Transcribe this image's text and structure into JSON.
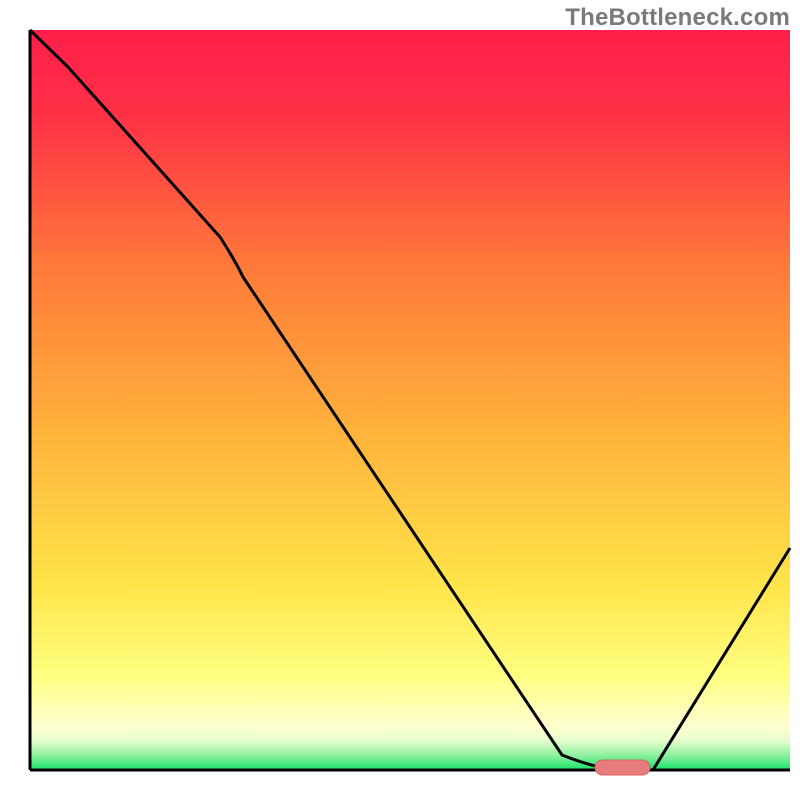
{
  "watermark": "TheBottleneck.com",
  "chart_data": {
    "type": "line",
    "title": "",
    "xlabel": "",
    "ylabel": "",
    "xlim": [
      0,
      100
    ],
    "ylim": [
      0,
      100
    ],
    "grid": false,
    "legend": false,
    "background_gradient": {
      "top": "#ff1e4b",
      "mid_upper": "#ff9933",
      "mid_lower": "#ffff66",
      "near_bottom": "#ffffcc",
      "bottom": "#17e36a"
    },
    "curve": {
      "name": "bottleneck-curve",
      "x": [
        0,
        5,
        25,
        28,
        70,
        78,
        82,
        100
      ],
      "y": [
        100,
        95,
        72,
        68,
        2,
        0,
        0,
        30
      ]
    },
    "marker": {
      "name": "optimal-point",
      "x": 78,
      "y": 0.1,
      "color": "#e46a6a",
      "width": 6,
      "height": 2,
      "shape": "rounded-bar"
    },
    "axes_color": "#000000",
    "curve_color": "#000000"
  }
}
